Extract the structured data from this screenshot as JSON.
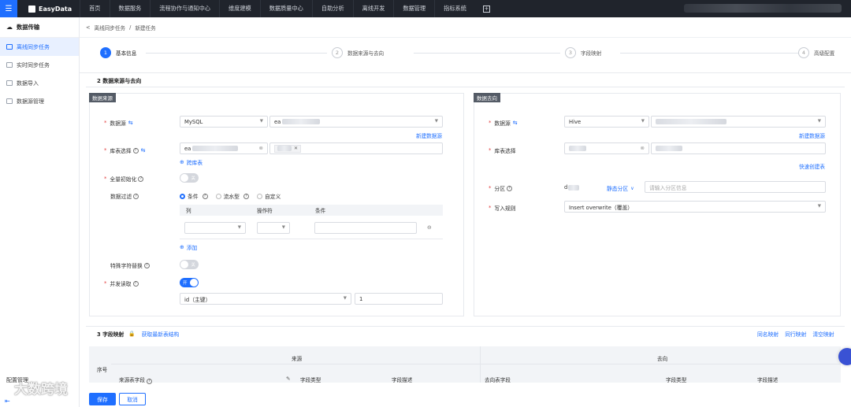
{
  "topbar": {
    "logo": "EasyData",
    "nav": [
      "首页",
      "数据服务",
      "流程协作与通知中心",
      "维度建模",
      "数据质量中心",
      "自助分析",
      "离线开发",
      "数据管理",
      "指标系统"
    ]
  },
  "sidebar": {
    "section": "数据传输",
    "items": [
      {
        "label": "离线同步任务",
        "active": true
      },
      {
        "label": "实时同步任务",
        "active": false
      },
      {
        "label": "数据导入",
        "active": false
      },
      {
        "label": "数据源管理",
        "active": false
      }
    ],
    "footer": "配置管理"
  },
  "breadcrumb": {
    "back": "<",
    "parent": "离线同步任务",
    "sep": "/",
    "current": "新建任务"
  },
  "steps": [
    {
      "num": "1",
      "label": "基本信息",
      "active": true
    },
    {
      "num": "2",
      "label": "数据来源与去向",
      "active": false
    },
    {
      "num": "3",
      "label": "字段映射",
      "active": false
    },
    {
      "num": "4",
      "label": "高级配置",
      "active": false
    }
  ],
  "section2": {
    "title": "2 数据来源与去向"
  },
  "source": {
    "tag": "数据来源",
    "datasource_label": "数据源",
    "datasource_type": "MySQL",
    "datasource_name_prefix": "ea",
    "new_datasource": "新建数据源",
    "table_label": "库表选择",
    "db_prefix": "ea",
    "cross_table": "跨库表",
    "full_init_label": "全量初始化",
    "full_init_toggle": "关",
    "filter_label": "数据过滤",
    "filter_options": [
      {
        "label": "条件",
        "checked": true
      },
      {
        "label": "流水型",
        "checked": false
      },
      {
        "label": "自定义",
        "checked": false
      }
    ],
    "filter_columns": [
      "列",
      "操作符",
      "条件"
    ],
    "add": "添加",
    "special_char_label": "特殊字符替换",
    "special_char_toggle": "关",
    "concurrent_label": "并发读取",
    "concurrent_toggle": "开",
    "split_key": "id（主键）",
    "concurrency": "1"
  },
  "target": {
    "tag": "数据去向",
    "datasource_label": "数据源",
    "datasource_type": "Hive",
    "new_datasource": "新建数据源",
    "table_label": "库表选择",
    "quick_create": "快速创建表",
    "partition_label": "分区",
    "partition_prefix": "d",
    "static_partition": "静态分区",
    "partition_placeholder": "请输入分区信息",
    "write_rule_label": "写入规则",
    "write_rule": "Insert overwrite（覆盖）"
  },
  "section3": {
    "title": "3 字段映射",
    "refresh": "获取最新表结构",
    "actions": [
      "同名映射",
      "同行映射",
      "清空映射"
    ],
    "col_index": "序号",
    "source_group": "来源",
    "target_group": "去向",
    "source_cols": [
      "来源表字段",
      "字段类型",
      "字段描述"
    ],
    "target_cols": [
      "去向表字段",
      "字段类型",
      "字段描述"
    ]
  },
  "buttons": {
    "save": "保存",
    "cancel": "取消"
  },
  "watermark": "大数跨境"
}
